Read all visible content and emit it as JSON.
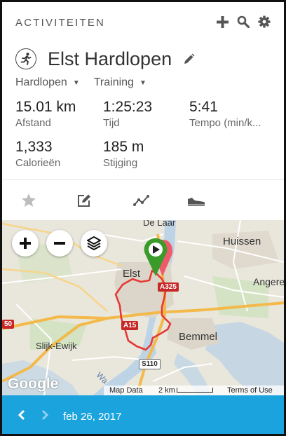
{
  "header": {
    "section_title": "ACTIVITEITEN"
  },
  "activity": {
    "title": "Elst Hardlopen",
    "type_label": "Hardlopen",
    "event_label": "Training"
  },
  "stats": [
    {
      "value": "15.01 km",
      "label": "Afstand"
    },
    {
      "value": "1:25:23",
      "label": "Tijd"
    },
    {
      "value": "5:41",
      "label": "Tempo (min/k..."
    },
    {
      "value": "1,333",
      "label": "Calorieën"
    },
    {
      "value": "185 m",
      "label": "Stijging"
    }
  ],
  "map": {
    "places": {
      "de_laar": "De Laar",
      "huissen": "Huissen",
      "elst": "Elst",
      "angeren": "Angere",
      "slijk_ewijk": "Slijk-Ewijk",
      "bemmel": "Bemmel",
      "wa": "Wa"
    },
    "roads": {
      "a325": "A325",
      "a15": "A15",
      "s110": "S110",
      "n50": "50"
    },
    "google": "Google",
    "attribution": {
      "map_data": "Map Data",
      "scale": "2 km",
      "terms": "Terms of Use"
    }
  },
  "footer": {
    "date": "feb 26, 2017"
  },
  "colors": {
    "accent": "#1aa3dd",
    "route": "#e53935",
    "start_marker": "#3a9a2a"
  }
}
